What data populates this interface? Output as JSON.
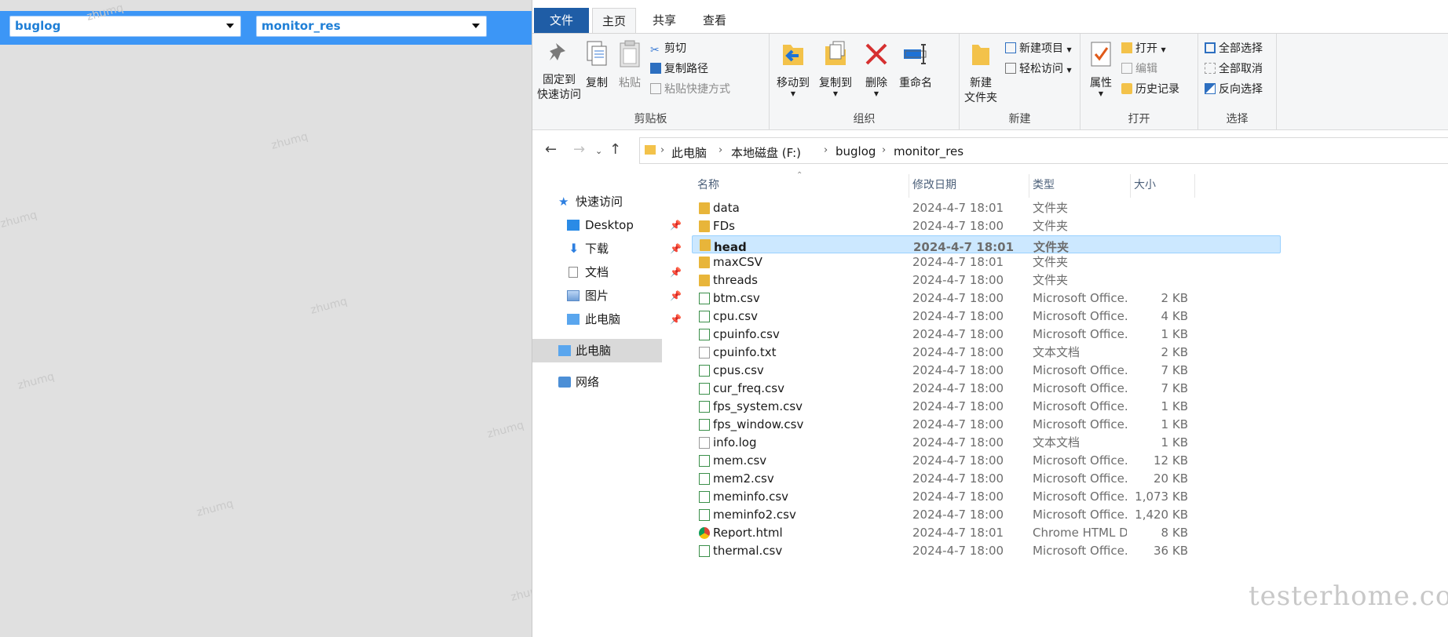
{
  "left_app": {
    "select1": "buglog",
    "select2": "monitor_res",
    "watermark": "zhumq"
  },
  "ribbon": {
    "tabs": [
      "文件",
      "主页",
      "共享",
      "查看"
    ],
    "clipboard": {
      "pin_line1": "固定到",
      "pin_line2": "快速访问",
      "copy": "复制",
      "paste": "粘贴",
      "cut": "剪切",
      "copy_path": "复制路径",
      "paste_shortcut": "粘贴快捷方式",
      "label": "剪贴板"
    },
    "organize": {
      "move_to": "移动到",
      "copy_to": "复制到",
      "delete": "删除",
      "rename": "重命名",
      "label": "组织"
    },
    "new": {
      "new_folder_line1": "新建",
      "new_folder_line2": "文件夹",
      "new_item": "新建项目",
      "easy_access": "轻松访问",
      "label": "新建"
    },
    "open": {
      "properties": "属性",
      "open": "打开",
      "edit": "编辑",
      "history": "历史记录",
      "label": "打开"
    },
    "select": {
      "select_all": "全部选择",
      "select_none": "全部取消",
      "invert": "反向选择",
      "label": "选择"
    }
  },
  "address": {
    "crumbs": [
      "此电脑",
      "本地磁盘 (F:)",
      "buglog",
      "monitor_res"
    ]
  },
  "navpane": {
    "quick_access": "快速访问",
    "items": [
      "Desktop",
      "下载",
      "文档",
      "图片",
      "此电脑"
    ],
    "this_pc": "此电脑",
    "network": "网络"
  },
  "columns": {
    "name": "名称",
    "date": "修改日期",
    "type": "类型",
    "size": "大小"
  },
  "files": [
    {
      "name": "data",
      "date": "2024-4-7 18:01",
      "type": "文件夹",
      "size": "",
      "kind": "folder"
    },
    {
      "name": "FDs",
      "date": "2024-4-7 18:00",
      "type": "文件夹",
      "size": "",
      "kind": "folder"
    },
    {
      "name": "head",
      "date": "2024-4-7 18:01",
      "type": "文件夹",
      "size": "",
      "kind": "folder"
    },
    {
      "name": "maxCSV",
      "date": "2024-4-7 18:01",
      "type": "文件夹",
      "size": "",
      "kind": "folder"
    },
    {
      "name": "threads",
      "date": "2024-4-7 18:00",
      "type": "文件夹",
      "size": "",
      "kind": "folder"
    },
    {
      "name": "btm.csv",
      "date": "2024-4-7 18:00",
      "type": "Microsoft Office...",
      "size": "2 KB",
      "kind": "xls"
    },
    {
      "name": "cpu.csv",
      "date": "2024-4-7 18:00",
      "type": "Microsoft Office...",
      "size": "4 KB",
      "kind": "xls"
    },
    {
      "name": "cpuinfo.csv",
      "date": "2024-4-7 18:00",
      "type": "Microsoft Office...",
      "size": "1 KB",
      "kind": "xls"
    },
    {
      "name": "cpuinfo.txt",
      "date": "2024-4-7 18:00",
      "type": "文本文档",
      "size": "2 KB",
      "kind": "txt"
    },
    {
      "name": "cpus.csv",
      "date": "2024-4-7 18:00",
      "type": "Microsoft Office...",
      "size": "7 KB",
      "kind": "xls"
    },
    {
      "name": "cur_freq.csv",
      "date": "2024-4-7 18:00",
      "type": "Microsoft Office...",
      "size": "7 KB",
      "kind": "xls"
    },
    {
      "name": "fps_system.csv",
      "date": "2024-4-7 18:00",
      "type": "Microsoft Office...",
      "size": "1 KB",
      "kind": "xls"
    },
    {
      "name": "fps_window.csv",
      "date": "2024-4-7 18:00",
      "type": "Microsoft Office...",
      "size": "1 KB",
      "kind": "xls"
    },
    {
      "name": "info.log",
      "date": "2024-4-7 18:00",
      "type": "文本文档",
      "size": "1 KB",
      "kind": "txt"
    },
    {
      "name": "mem.csv",
      "date": "2024-4-7 18:00",
      "type": "Microsoft Office...",
      "size": "12 KB",
      "kind": "xls"
    },
    {
      "name": "mem2.csv",
      "date": "2024-4-7 18:00",
      "type": "Microsoft Office...",
      "size": "20 KB",
      "kind": "xls"
    },
    {
      "name": "meminfo.csv",
      "date": "2024-4-7 18:00",
      "type": "Microsoft Office...",
      "size": "1,073 KB",
      "kind": "xls"
    },
    {
      "name": "meminfo2.csv",
      "date": "2024-4-7 18:00",
      "type": "Microsoft Office...",
      "size": "1,420 KB",
      "kind": "xls"
    },
    {
      "name": "Report.html",
      "date": "2024-4-7 18:01",
      "type": "Chrome HTML D...",
      "size": "8 KB",
      "kind": "chrome"
    },
    {
      "name": "thermal.csv",
      "date": "2024-4-7 18:00",
      "type": "Microsoft Office...",
      "size": "36 KB",
      "kind": "xls"
    }
  ],
  "selected_file": "head",
  "brand_watermark": "testerhome.com",
  "colors": {
    "left_bar": "#3c96f6",
    "file_tab": "#1f5da6",
    "selection": "#cce8ff"
  }
}
